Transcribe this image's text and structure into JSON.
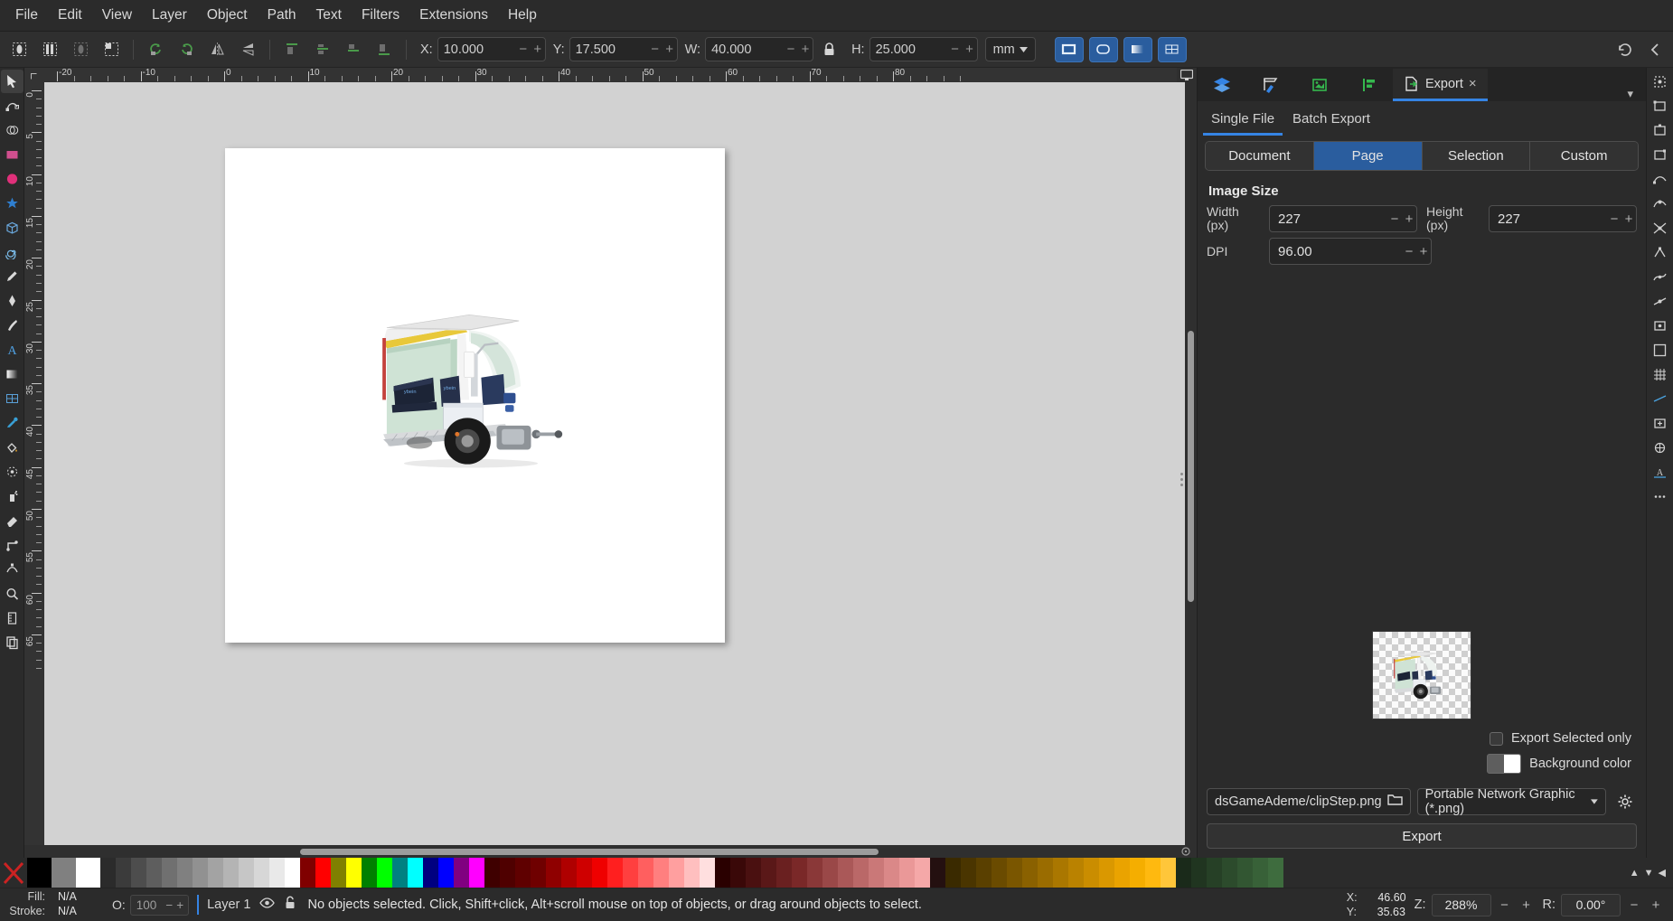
{
  "menu": {
    "items": [
      "File",
      "Edit",
      "View",
      "Layer",
      "Object",
      "Path",
      "Text",
      "Filters",
      "Extensions",
      "Help"
    ]
  },
  "toolbar": {
    "x_label": "X:",
    "x_value": "10.000",
    "y_label": "Y:",
    "y_value": "17.500",
    "w_label": "W:",
    "w_value": "40.000",
    "h_label": "H:",
    "h_value": "25.000",
    "unit": "mm",
    "lock_icon": "lock-icon",
    "select_all_icon": "select-all-icon",
    "select_all_layers_icon": "select-all-layers-icon",
    "deselect_icon": "deselect-icon",
    "invert_icon": "invert-selection-icon",
    "rotate_ccw_icon": "rotate-ccw-icon",
    "rotate_cw_icon": "rotate-cw-icon",
    "flip_h_icon": "flip-horizontal-icon",
    "flip_v_icon": "flip-vertical-icon",
    "raise_to_top_icon": "raise-to-top-icon",
    "raise_icon": "raise-icon",
    "lower_icon": "lower-icon",
    "lower_to_bottom_icon": "lower-to-bottom-icon",
    "affect_stroke_icon": "affect-stroke-width-icon",
    "affect_corners_icon": "affect-rounded-corners-icon",
    "affect_gradients_icon": "affect-gradients-icon",
    "affect_patterns_icon": "affect-patterns-icon",
    "history_icon": "command-history-icon",
    "collapse_icon": "collapse-panel-icon"
  },
  "toolbox": {
    "tools": [
      {
        "name": "selector-tool",
        "icon": "arrow-pointer-icon",
        "active": true
      },
      {
        "name": "node-tool",
        "icon": "node-editor-icon"
      },
      {
        "name": "shape-builder-tool",
        "icon": "shape-builder-icon"
      },
      {
        "name": "rectangle-tool",
        "icon": "rectangle-icon"
      },
      {
        "name": "ellipse-tool",
        "icon": "ellipse-icon"
      },
      {
        "name": "star-tool",
        "icon": "star-icon"
      },
      {
        "name": "3dbox-tool",
        "icon": "cube-icon"
      },
      {
        "name": "spiral-tool",
        "icon": "spiral-icon"
      },
      {
        "name": "pencil-tool",
        "icon": "pencil-icon"
      },
      {
        "name": "pen-tool",
        "icon": "bezier-pen-icon"
      },
      {
        "name": "calligraphy-tool",
        "icon": "calligraphy-icon"
      },
      {
        "name": "text-tool",
        "icon": "text-a-icon"
      },
      {
        "name": "gradient-tool",
        "icon": "gradient-icon"
      },
      {
        "name": "mesh-tool",
        "icon": "mesh-gradient-icon"
      },
      {
        "name": "dropper-tool",
        "icon": "eyedropper-icon"
      },
      {
        "name": "paintbucket-tool",
        "icon": "paint-bucket-icon"
      },
      {
        "name": "tweak-tool",
        "icon": "tweak-icon"
      },
      {
        "name": "spray-tool",
        "icon": "spray-can-icon"
      },
      {
        "name": "eraser-tool",
        "icon": "eraser-icon"
      },
      {
        "name": "connector-tool",
        "icon": "connector-icon"
      },
      {
        "name": "lpe-tool",
        "icon": "path-effect-icon"
      },
      {
        "name": "zoom-tool",
        "icon": "magnifier-icon"
      },
      {
        "name": "measure-tool",
        "icon": "measure-ruler-icon"
      },
      {
        "name": "pages-tool",
        "icon": "pages-icon"
      }
    ]
  },
  "rulers": {
    "unit": "mm",
    "h_labels": [
      "-20",
      "-10",
      "0",
      "10",
      "20",
      "30",
      "40",
      "50",
      "60",
      "70",
      "80"
    ],
    "v_labels": [
      "0",
      "5",
      "10",
      "15",
      "20",
      "25",
      "30",
      "35",
      "40",
      "45",
      "50",
      "55",
      "60",
      "65"
    ]
  },
  "export": {
    "panel_tab_label": "Export",
    "panel_tab_icon": "export-icon",
    "close_icon": "close-icon",
    "dock_icons": [
      "layers-icon",
      "fill-stroke-icon",
      "objects-icon",
      "align-distribute-icon"
    ],
    "chevron_icon": "chevron-down-icon",
    "mode_tabs": [
      {
        "label": "Single File",
        "selected": true
      },
      {
        "label": "Batch Export",
        "selected": false
      }
    ],
    "area_segments": [
      {
        "label": "Document",
        "selected": false
      },
      {
        "label": "Page",
        "selected": true
      },
      {
        "label": "Selection",
        "selected": false
      },
      {
        "label": "Custom",
        "selected": false
      }
    ],
    "image_size_heading": "Image Size",
    "width_label": "Width\n(px)",
    "width_label_line1": "Width",
    "width_label_line2": "(px)",
    "width_value": "227",
    "height_label_line1": "Height",
    "height_label_line2": "(px)",
    "height_value": "227",
    "dpi_label": "DPI",
    "dpi_value": "96.00",
    "minus": "−",
    "plus": "+",
    "export_selected_only_label": "Export Selected only",
    "background_color_label": "Background color",
    "filename": "dsGameAdeme/clipStep.png",
    "folder_icon": "open-folder-icon",
    "format": "Portable Network Graphic (*.png)",
    "format_chevron_icon": "chevron-down-icon",
    "settings_icon": "gear-icon",
    "export_button_label": "Export",
    "preview_alt": "export-preview-thumbnail"
  },
  "snapbar": {
    "icons": [
      "snap-enable-icon",
      "snap-bbox-icon",
      "snap-bbox-edge-icon",
      "snap-bbox-corner-icon",
      "snap-nodes-icon",
      "snap-paths-icon",
      "snap-path-intersection-icon",
      "snap-cusp-node-icon",
      "snap-smooth-node-icon",
      "snap-midpoint-icon",
      "snap-center-icon",
      "snap-page-border-icon",
      "snap-grid-icon",
      "snap-guide-icon",
      "snap-object-center-icon",
      "snap-rotation-center-icon",
      "snap-text-baseline-icon",
      "snap-more-icon"
    ]
  },
  "palette": {
    "special": [
      "none",
      "#000000",
      "#808080",
      "#ffffff"
    ],
    "colors": [
      "#2b2b2b",
      "#3b3b3b",
      "#4d4d4d",
      "#5e5e5e",
      "#707070",
      "#808080",
      "#919191",
      "#a3a3a3",
      "#b4b4b4",
      "#c6c6c6",
      "#d7d7d7",
      "#e9e9e9",
      "#ffffff",
      "#800000",
      "#ff0000",
      "#808000",
      "#ffff00",
      "#008000",
      "#00ff00",
      "#008080",
      "#00ffff",
      "#000080",
      "#0000ff",
      "#800080",
      "#ff00ff",
      "#3f0000",
      "#4f0000",
      "#5f0000",
      "#6f0000",
      "#8f0000",
      "#af0000",
      "#cf0000",
      "#ef0000",
      "#ff1f1f",
      "#ff3f3f",
      "#ff5f5f",
      "#ff7f7f",
      "#ff9f9f",
      "#ffbfbf",
      "#ffdfdf",
      "#2a0000",
      "#3a0808",
      "#4a1010",
      "#5a1818",
      "#6a2020",
      "#7a2828",
      "#8a3838",
      "#9a4848",
      "#aa5858",
      "#ba6868",
      "#ca7878",
      "#da8888",
      "#ea9898",
      "#f5a8a8",
      "#241010",
      "#3a2a00",
      "#4a3500",
      "#5a4000",
      "#6a4b00",
      "#7a5600",
      "#8a6100",
      "#9a6c00",
      "#aa7700",
      "#ba8200",
      "#ca8d00",
      "#da9800",
      "#eaa300",
      "#f5ae00",
      "#ffb90f",
      "#ffc63a",
      "#1a2a1a",
      "#203520",
      "#264026",
      "#2c4b2c",
      "#325632",
      "#386138",
      "#3e6c3e"
    ],
    "scroll_up_icon": "chevron-up-icon",
    "scroll_down_icon": "chevron-down-icon",
    "menu_icon": "palette-menu-icon"
  },
  "status": {
    "fill_label": "Fill:",
    "fill_value": "N/A",
    "stroke_label": "Stroke:",
    "stroke_value": "N/A",
    "opacity_label": "O:",
    "opacity_value": "100",
    "layer_name": "Layer 1",
    "layer_visible_icon": "eye-icon",
    "layer_lock_icon": "unlock-icon",
    "message": "No objects selected. Click, Shift+click, Alt+scroll mouse on top of objects, or drag around objects to select.",
    "x_label": "X:",
    "x_value": "46.60",
    "y_label": "Y:",
    "y_value": "35.63",
    "zoom_label": "Z:",
    "zoom_value": "288%",
    "rotation_label": "R:",
    "rotation_value": "0.00°"
  },
  "colors": {
    "accent": "#3584e4",
    "accent_dark": "#2a5d9e",
    "panel_bg": "#2b2b2b",
    "canvas_bg": "#d2d2d2",
    "page_bg": "#ffffff"
  }
}
